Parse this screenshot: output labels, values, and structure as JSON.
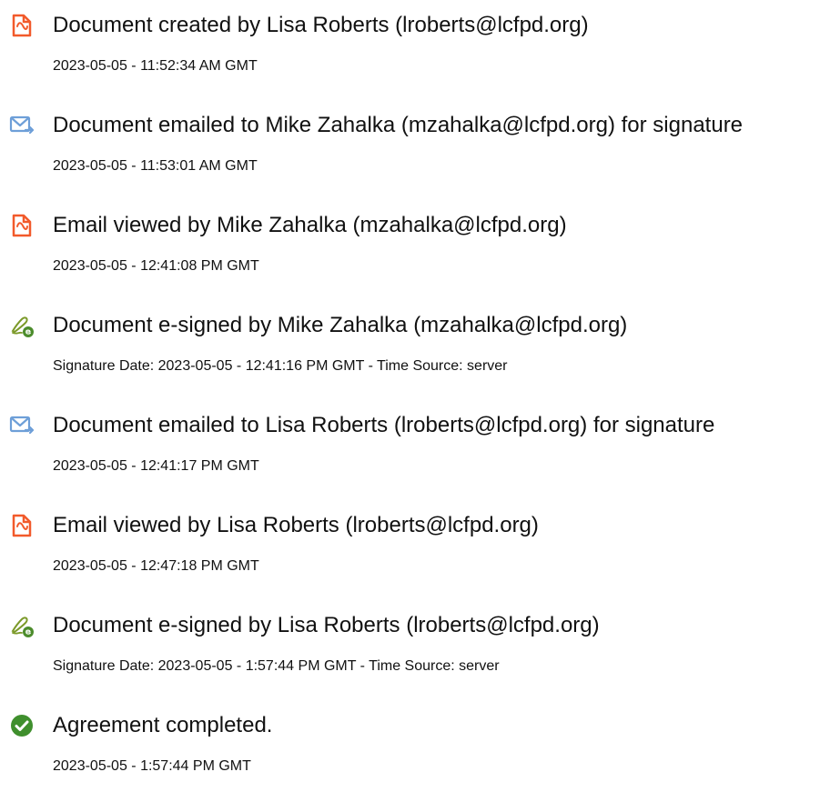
{
  "colors": {
    "document_icon": "#F25A2B",
    "email_icon": "#6E9FD8",
    "esign_icon": "#7C9A2A",
    "esign_badge": "#4C8C2C",
    "complete_icon": "#3F8F2D"
  },
  "events": [
    {
      "icon": "document-icon",
      "title": "Document created by Lisa Roberts (lroberts@lcfpd.org)",
      "time": "2023-05-05 - 11:52:34 AM GMT"
    },
    {
      "icon": "email-sent-icon",
      "title": "Document emailed to Mike Zahalka (mzahalka@lcfpd.org) for signature",
      "time": "2023-05-05 - 11:53:01 AM GMT"
    },
    {
      "icon": "document-icon",
      "title": "Email viewed by Mike Zahalka (mzahalka@lcfpd.org)",
      "time": "2023-05-05 - 12:41:08 PM GMT"
    },
    {
      "icon": "esign-pen-icon",
      "title": "Document e-signed by Mike Zahalka (mzahalka@lcfpd.org)",
      "time": "Signature Date: 2023-05-05 - 12:41:16 PM GMT - Time Source: server"
    },
    {
      "icon": "email-sent-icon",
      "title": "Document emailed to Lisa Roberts (lroberts@lcfpd.org) for signature",
      "time": "2023-05-05 - 12:41:17 PM GMT"
    },
    {
      "icon": "document-icon",
      "title": "Email viewed by Lisa Roberts (lroberts@lcfpd.org)",
      "time": "2023-05-05 - 12:47:18 PM GMT"
    },
    {
      "icon": "esign-pen-icon",
      "title": "Document e-signed by Lisa Roberts (lroberts@lcfpd.org)",
      "time": "Signature Date: 2023-05-05 - 1:57:44 PM GMT - Time Source: server"
    },
    {
      "icon": "check-circle-icon",
      "title": "Agreement completed.",
      "time": "2023-05-05 - 1:57:44 PM GMT"
    }
  ]
}
